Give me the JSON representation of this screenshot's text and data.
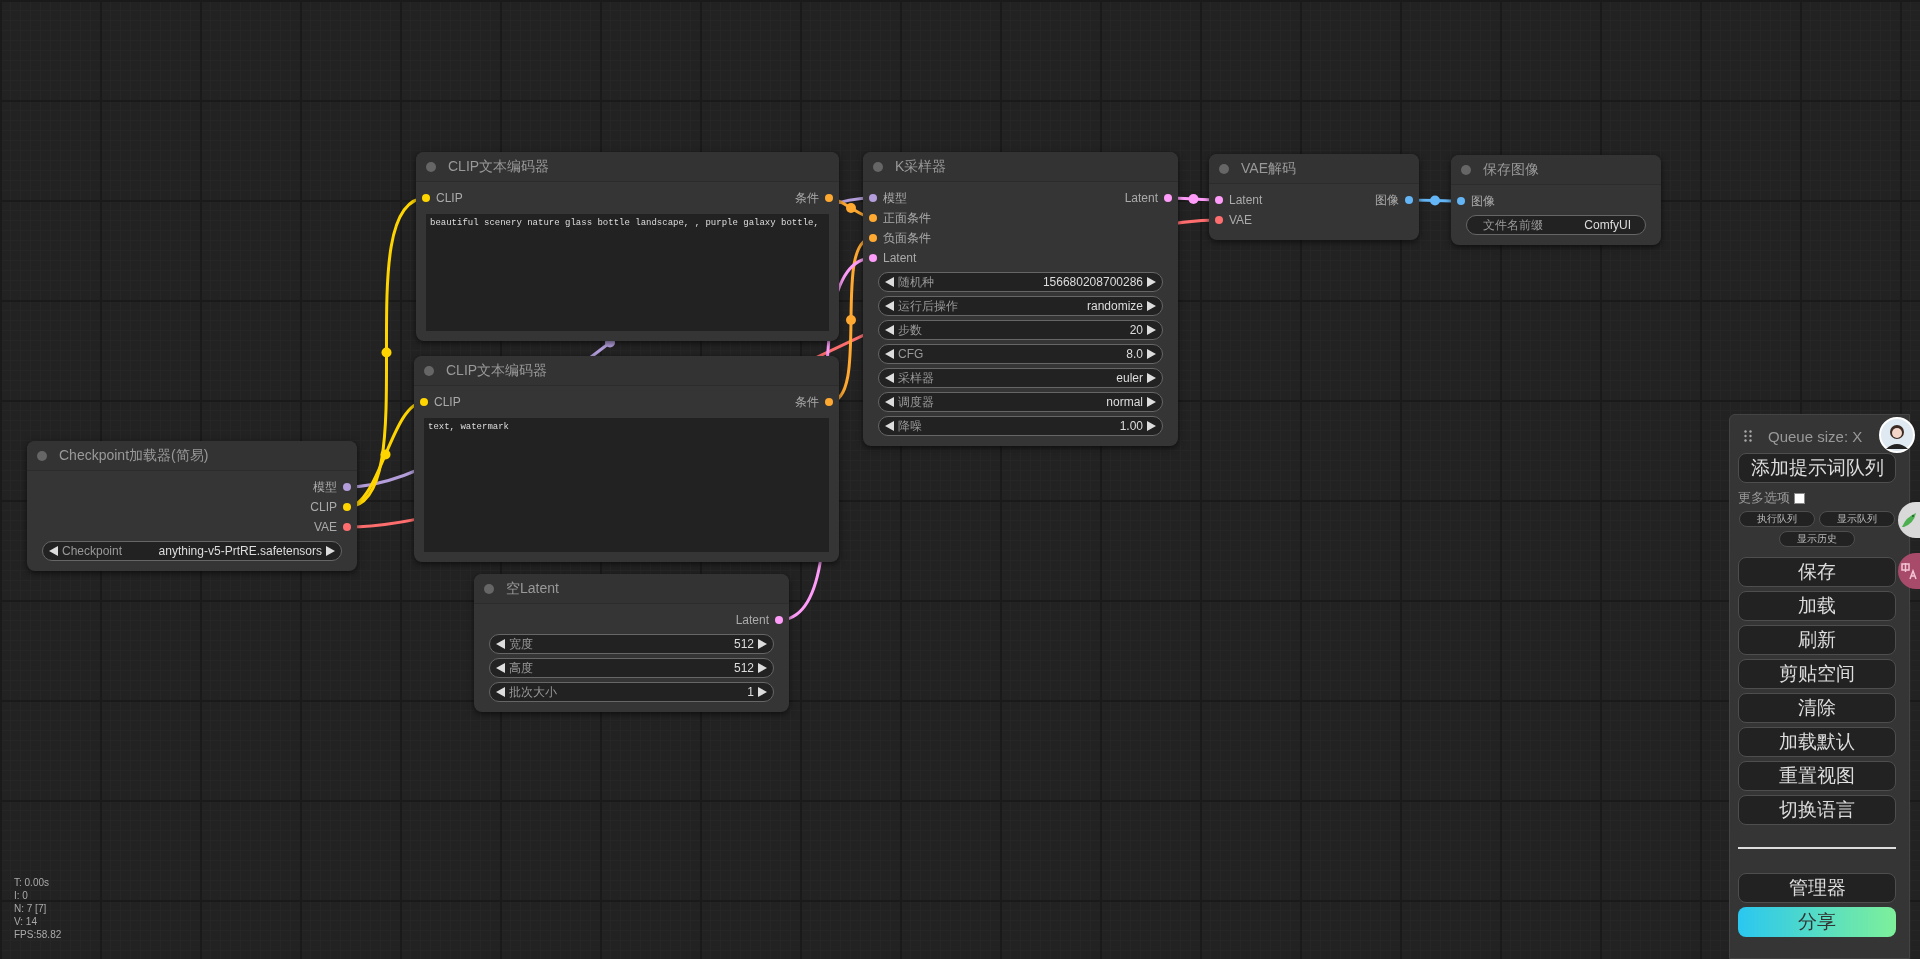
{
  "nodes": [
    {
      "title": "CLIP文本编码器",
      "inputs": [
        {
          "label": "CLIP",
          "color": "#ffd500"
        }
      ],
      "outputs": [
        {
          "label": "条件",
          "color": "#ffa931"
        }
      ],
      "text": "beautiful scenery nature glass bottle landscape, , purple galaxy bottle,"
    },
    {
      "title": "K采样器",
      "inputs": [
        {
          "label": "模型",
          "color": "#b39ddb"
        },
        {
          "label": "正面条件",
          "color": "#ffa931"
        },
        {
          "label": "负面条件",
          "color": "#ffa931"
        },
        {
          "label": "Latent",
          "color": "#ff9cf9"
        }
      ],
      "outputs": [
        {
          "label": "Latent",
          "color": "#ff9cf9"
        }
      ],
      "widgets": [
        {
          "kind": "number",
          "label": "随机种",
          "value": "156680208700286"
        },
        {
          "kind": "combo",
          "label": "运行后操作",
          "value": "randomize"
        },
        {
          "kind": "number",
          "label": "步数",
          "value": "20"
        },
        {
          "kind": "number",
          "label": "CFG",
          "value": "8.0"
        },
        {
          "kind": "combo",
          "label": "采样器",
          "value": "euler"
        },
        {
          "kind": "combo",
          "label": "调度器",
          "value": "normal"
        },
        {
          "kind": "number",
          "label": "降噪",
          "value": "1.00"
        }
      ]
    },
    {
      "title": "VAE解码",
      "inputs": [
        {
          "label": "Latent",
          "color": "#ff9cf9"
        },
        {
          "label": "VAE",
          "color": "#ff6e6e"
        }
      ],
      "outputs": [
        {
          "label": "图像",
          "color": "#64b5f6"
        }
      ]
    },
    {
      "title": "保存图像",
      "inputs": [
        {
          "label": "图像",
          "color": "#64b5f6"
        }
      ],
      "widgets": [
        {
          "kind": "text",
          "label": "文件名前缀",
          "value": "ComfyUI"
        }
      ]
    },
    {
      "title": "CLIP文本编码器",
      "inputs": [
        {
          "label": "CLIP",
          "color": "#ffd500"
        }
      ],
      "outputs": [
        {
          "label": "条件",
          "color": "#ffa931"
        }
      ],
      "text": "text, watermark"
    },
    {
      "title": "Checkpoint加载器(简易)",
      "outputs": [
        {
          "label": "模型",
          "color": "#b39ddb"
        },
        {
          "label": "CLIP",
          "color": "#ffd500"
        },
        {
          "label": "VAE",
          "color": "#ff6e6e"
        }
      ],
      "widgets": [
        {
          "kind": "combo",
          "label": "Checkpoint",
          "value": "anything-v5-PrtRE.safetensors"
        }
      ]
    },
    {
      "title": "空Latent",
      "outputs": [
        {
          "label": "Latent",
          "color": "#ff9cf9"
        }
      ],
      "widgets": [
        {
          "kind": "number",
          "label": "宽度",
          "value": "512"
        },
        {
          "kind": "number",
          "label": "高度",
          "value": "512"
        },
        {
          "kind": "number",
          "label": "批次大小",
          "value": "1"
        }
      ]
    }
  ],
  "stats": [
    "T: 0.00s",
    "I: 0",
    "N: 7 [7]",
    "V: 14",
    "FPS:58.82"
  ],
  "queue_panel": {
    "title": "Queue size: X",
    "primary_button": "添加提示词队列",
    "more_options": {
      "label": "更多选项",
      "checked": false
    },
    "small_buttons": [
      "执行队列",
      "显示队列",
      "显示历史"
    ],
    "buttons": [
      "保存",
      "加载",
      "刷新",
      "剪贴空间",
      "清除",
      "加载默认",
      "重置视图",
      "切换语言"
    ],
    "bottom_buttons": [
      {
        "label": "管理器",
        "kind": "plain"
      },
      {
        "label": "分享",
        "kind": "gradient"
      }
    ]
  }
}
